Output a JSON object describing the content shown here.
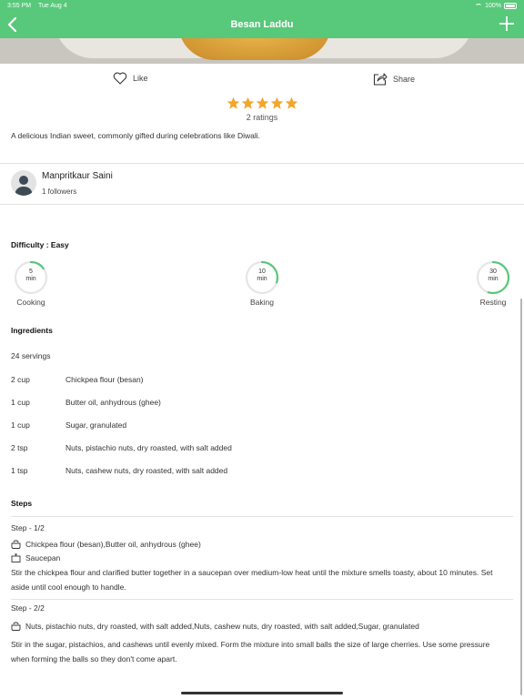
{
  "status_bar": {
    "time": "3:55 PM",
    "date": "Tue Aug 4",
    "battery": "100%"
  },
  "header": {
    "title": "Besan Laddu"
  },
  "actions": {
    "like_label": "Like",
    "share_label": "Share"
  },
  "rating": {
    "stars": 5,
    "count_label": "2 ratings",
    "star_color": "#f4a62a"
  },
  "description": "A delicious Indian sweet, commonly gifted during celebrations like Diwali.",
  "author": {
    "name": "Manpritkaur Saini",
    "followers": "1 followers"
  },
  "difficulty": "Difficulty : Easy",
  "timers": [
    {
      "value": "5",
      "unit": "min",
      "label": "Cooking",
      "progress": 0.15
    },
    {
      "value": "10",
      "unit": "min",
      "label": "Baking",
      "progress": 0.3
    },
    {
      "value": "30",
      "unit": "min",
      "label": "Resting",
      "progress": 0.55
    }
  ],
  "ingredients": {
    "heading": "Ingredients",
    "servings": "24 servings",
    "items": [
      {
        "qty": "2  cup",
        "name": "Chickpea flour (besan)"
      },
      {
        "qty": "1  cup",
        "name": "Butter oil, anhydrous (ghee)"
      },
      {
        "qty": "1  cup",
        "name": "Sugar, granulated"
      },
      {
        "qty": "2  tsp",
        "name": "Nuts, pistachio nuts, dry roasted, with salt added"
      },
      {
        "qty": "1  tsp",
        "name": "Nuts, cashew nuts, dry roasted, with salt added"
      }
    ]
  },
  "steps": {
    "heading": "Steps",
    "items": [
      {
        "label": "Step - 1/2",
        "ingredients": "Chickpea flour (besan),Butter oil, anhydrous (ghee)",
        "tool": "Saucepan",
        "text": "Stir the chickpea flour and clarified butter together in a saucepan over medium-low heat until the mixture smells toasty, about 10 minutes. Set aside until cool enough to handle."
      },
      {
        "label": "Step - 2/2",
        "ingredients": "Nuts, pistachio nuts, dry roasted, with salt added,Nuts, cashew nuts, dry roasted, with salt added,Sugar, granulated",
        "text": "Stir in the sugar, pistachios, and cashews until evenly mixed. Form the mixture into small balls the size of large cherries. Use some pressure when forming the balls so they don't come apart."
      }
    ]
  },
  "colors": {
    "header_bg": "#58c87a",
    "timer_ring": "#58c87a"
  }
}
